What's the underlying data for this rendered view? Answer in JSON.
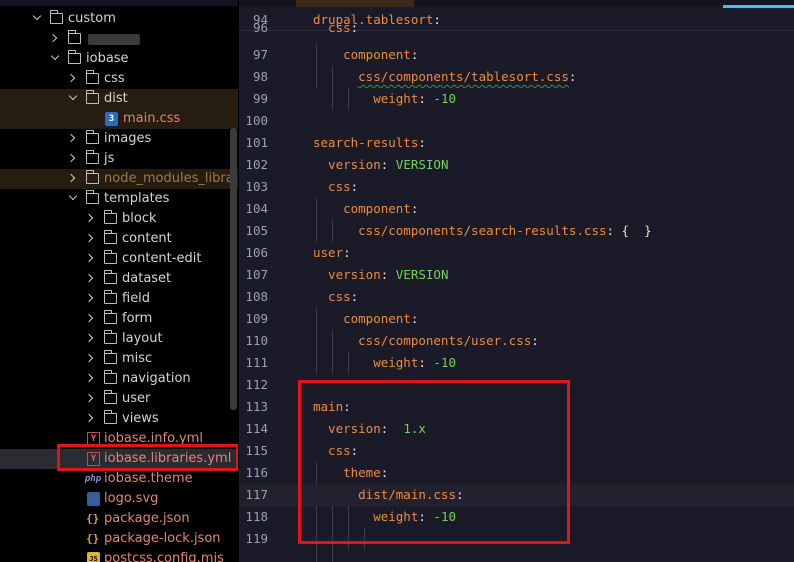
{
  "explorer": {
    "rows": [
      {
        "label": "custom"
      },
      {
        "label": ""
      },
      {
        "label": "iobase"
      },
      {
        "label": "css"
      },
      {
        "label": "dist"
      },
      {
        "label": "main.css"
      },
      {
        "label": "images"
      },
      {
        "label": "js"
      },
      {
        "label": "node_modules_libra"
      },
      {
        "label": "templates"
      },
      {
        "label": "block"
      },
      {
        "label": "content"
      },
      {
        "label": "content-edit"
      },
      {
        "label": "dataset"
      },
      {
        "label": "field"
      },
      {
        "label": "form"
      },
      {
        "label": "layout"
      },
      {
        "label": "misc"
      },
      {
        "label": "navigation"
      },
      {
        "label": "user"
      },
      {
        "label": "views"
      },
      {
        "label": "iobase.info.yml"
      },
      {
        "label": "iobase.libraries.yml"
      },
      {
        "label": "iobase.theme"
      },
      {
        "label": "logo.svg"
      },
      {
        "label": "package.json"
      },
      {
        "label": "package-lock.json"
      },
      {
        "label": "postcss.config.mjs"
      }
    ],
    "icons": {
      "css": "3",
      "yml": "Y",
      "php": "php",
      "json": "{}",
      "js": "JS"
    }
  },
  "editor": {
    "lines": [
      {
        "num": "94",
        "parts": [
          {
            "t": "drupal.tablesort",
            "c": "k"
          },
          {
            "t": ":",
            "c": "p"
          }
        ]
      },
      {
        "num": "96",
        "parts": [
          {
            "t": "  css",
            "c": "k"
          },
          {
            "t": ":",
            "c": "p"
          }
        ]
      },
      {
        "num": "97",
        "parts": [
          {
            "t": "    component",
            "c": "k"
          },
          {
            "t": ":",
            "c": "p"
          }
        ]
      },
      {
        "num": "98",
        "parts": [
          {
            "t": "      ",
            "c": "p"
          },
          {
            "t": "css/components/tablesort.css",
            "c": "s"
          },
          {
            "t": ":",
            "c": "p"
          }
        ]
      },
      {
        "num": "99",
        "parts": [
          {
            "t": "        weight",
            "c": "k"
          },
          {
            "t": ": ",
            "c": "p"
          },
          {
            "t": "-10",
            "c": "v"
          }
        ]
      },
      {
        "num": "100",
        "parts": []
      },
      {
        "num": "101",
        "parts": [
          {
            "t": "search-results",
            "c": "k"
          },
          {
            "t": ":",
            "c": "p"
          }
        ]
      },
      {
        "num": "102",
        "parts": [
          {
            "t": "  version",
            "c": "k"
          },
          {
            "t": ": ",
            "c": "p"
          },
          {
            "t": "VERSION",
            "c": "v"
          }
        ]
      },
      {
        "num": "103",
        "parts": [
          {
            "t": "  css",
            "c": "k"
          },
          {
            "t": ":",
            "c": "p"
          }
        ]
      },
      {
        "num": "104",
        "parts": [
          {
            "t": "    component",
            "c": "k"
          },
          {
            "t": ":",
            "c": "p"
          }
        ]
      },
      {
        "num": "105",
        "parts": [
          {
            "t": "      css/components/search-results.css",
            "c": "s"
          },
          {
            "t": ": {  }",
            "c": "p"
          }
        ]
      },
      {
        "num": "106",
        "parts": [
          {
            "t": "user",
            "c": "k"
          },
          {
            "t": ":",
            "c": "p"
          }
        ]
      },
      {
        "num": "107",
        "parts": [
          {
            "t": "  version",
            "c": "k"
          },
          {
            "t": ": ",
            "c": "p"
          },
          {
            "t": "VERSION",
            "c": "v"
          }
        ]
      },
      {
        "num": "108",
        "parts": [
          {
            "t": "  css",
            "c": "k"
          },
          {
            "t": ":",
            "c": "p"
          }
        ]
      },
      {
        "num": "109",
        "parts": [
          {
            "t": "    component",
            "c": "k"
          },
          {
            "t": ":",
            "c": "p"
          }
        ]
      },
      {
        "num": "110",
        "parts": [
          {
            "t": "      css/components/user.css",
            "c": "s"
          },
          {
            "t": ":",
            "c": "p"
          }
        ]
      },
      {
        "num": "111",
        "parts": [
          {
            "t": "        weight",
            "c": "k"
          },
          {
            "t": ": ",
            "c": "p"
          },
          {
            "t": "-10",
            "c": "v"
          }
        ]
      },
      {
        "num": "112",
        "parts": []
      },
      {
        "num": "113",
        "parts": [
          {
            "t": "main",
            "c": "k"
          },
          {
            "t": ":",
            "c": "p"
          }
        ]
      },
      {
        "num": "114",
        "parts": [
          {
            "t": "  version",
            "c": "k"
          },
          {
            "t": ":  ",
            "c": "p"
          },
          {
            "t": "1.x",
            "c": "v"
          }
        ]
      },
      {
        "num": "115",
        "parts": [
          {
            "t": "  css",
            "c": "k"
          },
          {
            "t": ":",
            "c": "p"
          }
        ]
      },
      {
        "num": "116",
        "parts": [
          {
            "t": "    theme",
            "c": "k"
          },
          {
            "t": ":",
            "c": "p"
          }
        ]
      },
      {
        "num": "117",
        "parts": [
          {
            "t": "      dist/main.css",
            "c": "s"
          },
          {
            "t": ":",
            "c": "p"
          }
        ]
      },
      {
        "num": "118",
        "parts": [
          {
            "t": "        weight",
            "c": "k"
          },
          {
            "t": ": ",
            "c": "p"
          },
          {
            "t": "-10",
            "c": "v"
          }
        ]
      },
      {
        "num": "119",
        "parts": []
      }
    ]
  },
  "colors": {
    "explorer_bg": "#000000",
    "editor_bg": "#1b1a28",
    "key": "#f08a3c",
    "value": "#6ed45a",
    "line_number": "#9aa0ac",
    "highlight_box": "#e0151c"
  }
}
